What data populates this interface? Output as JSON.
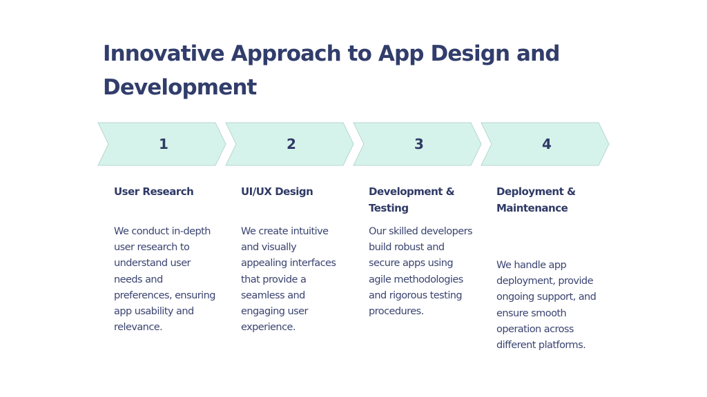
{
  "slide": {
    "title": "Innovative Approach to App Design and Development",
    "colors": {
      "title": "#313d6b",
      "chevron_fill": "#d5f3ea",
      "chevron_stroke": "#b9d6ce",
      "body_text": "#3a4470"
    }
  },
  "steps": [
    {
      "number": "1",
      "heading": "User Research",
      "description": "We conduct in-depth user research to understand user needs and preferences, ensuring app usability and relevance."
    },
    {
      "number": "2",
      "heading": "UI/UX Design",
      "description": "We create intuitive and visually appealing interfaces that provide a seamless and engaging user experience."
    },
    {
      "number": "3",
      "heading": "Development & Testing",
      "description": "Our skilled developers build robust and secure apps using agile methodologies and rigorous testing procedures."
    },
    {
      "number": "4",
      "heading": "Deployment & Maintenance",
      "description": "We handle app deployment, provide ongoing support, and ensure smooth operation across different platforms."
    }
  ]
}
